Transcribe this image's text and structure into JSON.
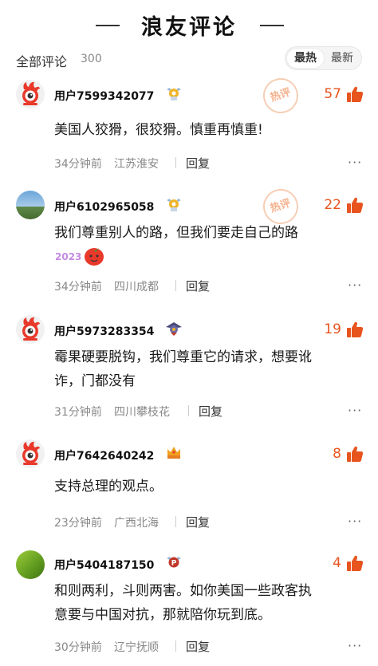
{
  "header": {
    "title": "浪友评论"
  },
  "subbar": {
    "all_label": "全部评论",
    "count": "300",
    "sort_hot": "最热",
    "sort_new": "最新"
  },
  "stamp_text": "热评",
  "reply_label": "回复",
  "more_label": "···",
  "comments": [
    {
      "user": "用户7599342077",
      "likes": "57",
      "text": "美国人狡猾，很狡猾。慎重再慎重!",
      "time": "34分钟前",
      "location": "江苏淮安",
      "hot": true
    },
    {
      "user": "用户6102965058",
      "likes": "22",
      "text": "我们尊重别人的路，但我们要走自己的路",
      "sticker": "2023",
      "time": "34分钟前",
      "location": "四川成都",
      "hot": true
    },
    {
      "user": "用户5973283354",
      "likes": "19",
      "text_line1": "霉果硬要脱钩，我们尊重它的请求，想要讹",
      "text_line2": "诈，门都没有",
      "time": "31分钟前",
      "location": "四川攀枝花"
    },
    {
      "user": "用户7642640242",
      "likes": "8",
      "text": "支持总理的观点。",
      "time": "23分钟前",
      "location": "广西北海"
    },
    {
      "user": "用户5404187150",
      "likes": "4",
      "text_line1": "和则两利，斗则两害。如你美国一些政客执",
      "text_line2": "意要与中国对抗，那就陪你玩到底。",
      "time": "30分钟前",
      "location": "辽宁抚顺"
    }
  ],
  "colors": {
    "accent": "#e8541e",
    "stamp": "#f4a981",
    "muted": "#888888"
  }
}
